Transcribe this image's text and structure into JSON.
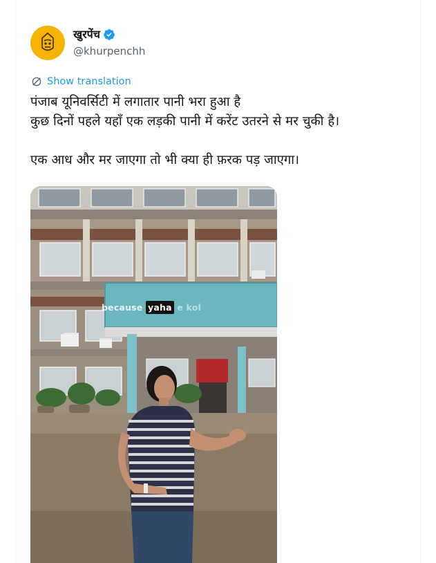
{
  "author": {
    "display_name": "खुरपेंच",
    "handle": "@khurpenchh",
    "verified": true,
    "avatar_color": "#f6b400",
    "avatar_icon": "khurpench-logo-icon"
  },
  "translate": {
    "label": "Show translation",
    "icon": "translate-icon",
    "color": "#1d9bf0"
  },
  "tweet": {
    "text": "पंजाब यूनिवर्सिटी में लगातार पानी भरा हुआ है\nकुछ दिनों पहले यहाँ एक लड़की पानी में करेंट उतरने से मर चुकी है।\n\nएक आध और मर जाएगा तो भी क्या ही फ़रक पड़ जाएगा।"
  },
  "media": {
    "type": "video",
    "caption_before": "because ",
    "caption_highlight": "yaha",
    "caption_after": " e kol"
  },
  "colors": {
    "text": "#0f1419",
    "muted": "#536471",
    "accent": "#1d9bf0"
  }
}
